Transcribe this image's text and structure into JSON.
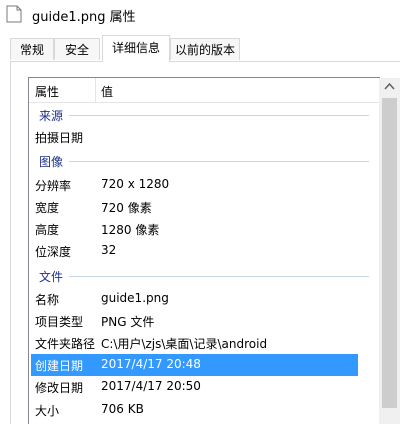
{
  "window": {
    "title": "guide1.png 属性"
  },
  "tabs": [
    {
      "label": "常规",
      "active": false
    },
    {
      "label": "安全",
      "active": false
    },
    {
      "label": "详细信息",
      "active": true
    },
    {
      "label": "以前的版本",
      "active": false
    }
  ],
  "table": {
    "header": {
      "property": "属性",
      "value": "值"
    },
    "groups": {
      "source": "来源",
      "image": "图像",
      "file": "文件"
    },
    "rows": {
      "date_taken": {
        "property": "拍摄日期",
        "value": ""
      },
      "dimensions": {
        "property": "分辨率",
        "value": "720 x 1280"
      },
      "width": {
        "property": "宽度",
        "value": "720 像素"
      },
      "height": {
        "property": "高度",
        "value": "1280 像素"
      },
      "bit_depth": {
        "property": "位深度",
        "value": "32"
      },
      "name": {
        "property": "名称",
        "value": "guide1.png"
      },
      "item_type": {
        "property": "项目类型",
        "value": "PNG 文件"
      },
      "folder_path": {
        "property": "文件夹路径",
        "value": "C:\\用户\\zjs\\桌面\\记录\\android"
      },
      "date_created": {
        "property": "创建日期",
        "value": "2017/4/17 20:48",
        "selected": true
      },
      "date_modified": {
        "property": "修改日期",
        "value": "2017/4/17 20:50"
      },
      "size": {
        "property": "大小",
        "value": "706 KB"
      }
    }
  },
  "colors": {
    "group_label": "#1e3287",
    "selection": "#3399ff"
  }
}
